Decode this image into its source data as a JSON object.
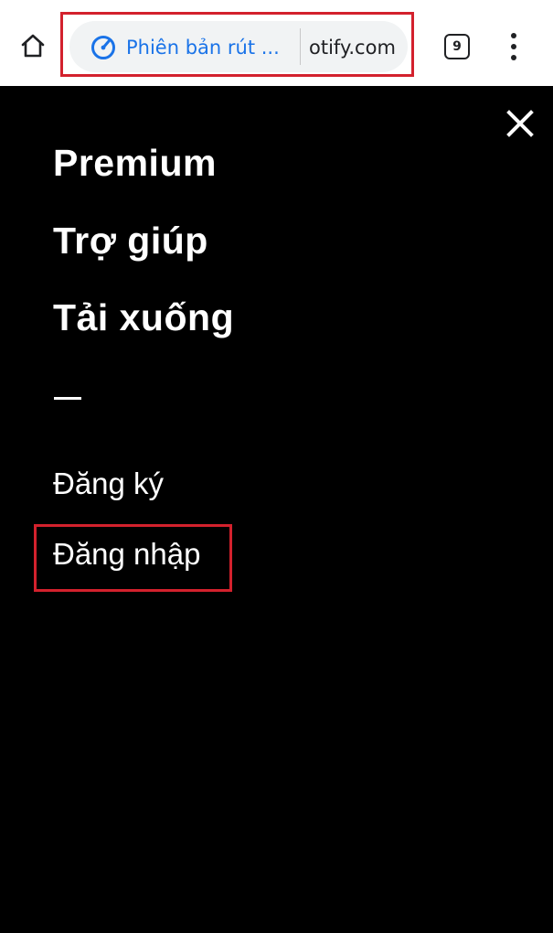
{
  "browser": {
    "lite_mode_label": "Phiên bản rút ...",
    "url_visible": "otify.com",
    "tab_count": "9",
    "icons": {
      "home": "home-icon",
      "lite_mode": "lite-mode-gauge-icon",
      "menu": "more-vert-icon"
    },
    "colors": {
      "bar_bg": "#ffffff",
      "omnibox_bg": "#f1f3f4",
      "lite_accent": "#1a73e8",
      "highlight": "#d3212d"
    }
  },
  "menu": {
    "close_icon": "close-icon",
    "primary_links": [
      {
        "label": "Premium"
      },
      {
        "label": "Trợ giúp"
      },
      {
        "label": "Tải xuống"
      }
    ],
    "secondary_links": [
      {
        "label": "Đăng ký"
      },
      {
        "label": "Đăng nhập"
      }
    ],
    "background": "#000000",
    "text_color": "#ffffff"
  }
}
